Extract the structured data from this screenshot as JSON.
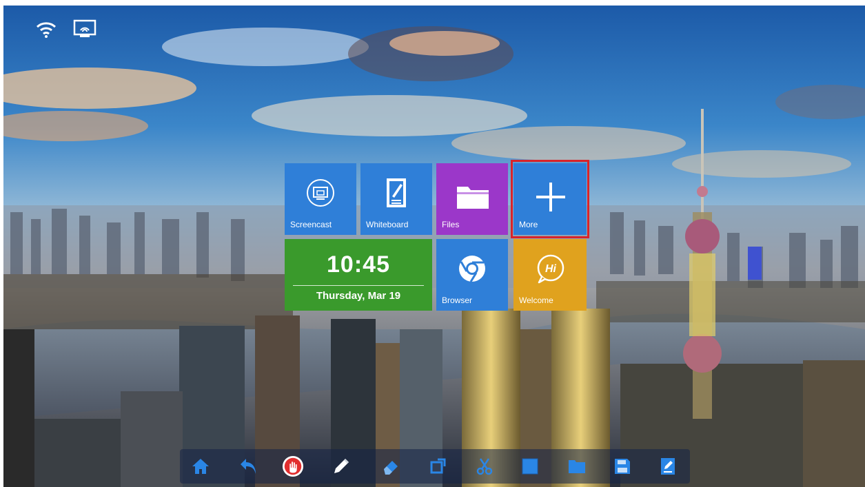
{
  "tiles": {
    "screencast": {
      "label": "Screencast",
      "icon": "screencast-icon",
      "color": "#2f7fd8"
    },
    "whiteboard": {
      "label": "Whiteboard",
      "icon": "whiteboard-icon",
      "color": "#2f7fd8"
    },
    "files": {
      "label": "Files",
      "icon": "folder-icon",
      "color": "#9b37c9"
    },
    "more": {
      "label": "More",
      "icon": "plus-icon",
      "color": "#2f7fd8"
    },
    "clock": {
      "time": "10:45",
      "date": "Thursday, Mar 19",
      "color": "#3a9a2c"
    },
    "browser": {
      "label": "Browser",
      "icon": "chrome-icon",
      "color": "#2f7fd8"
    },
    "welcome": {
      "label": "Welcome",
      "icon": "hi-bubble-icon",
      "color": "#e0a21e"
    }
  },
  "status_bar": {
    "icons": [
      "wifi-icon",
      "screen-share-icon"
    ]
  },
  "toolbar": {
    "icons": [
      "home-icon",
      "undo-icon",
      "stop-hand-icon",
      "pen-icon",
      "eraser-icon",
      "crop-icon",
      "scissors-icon",
      "square-icon",
      "folder-icon",
      "save-icon",
      "edit-note-icon"
    ],
    "accent": "#2a86e6"
  },
  "highlight_color": "#d9232a"
}
